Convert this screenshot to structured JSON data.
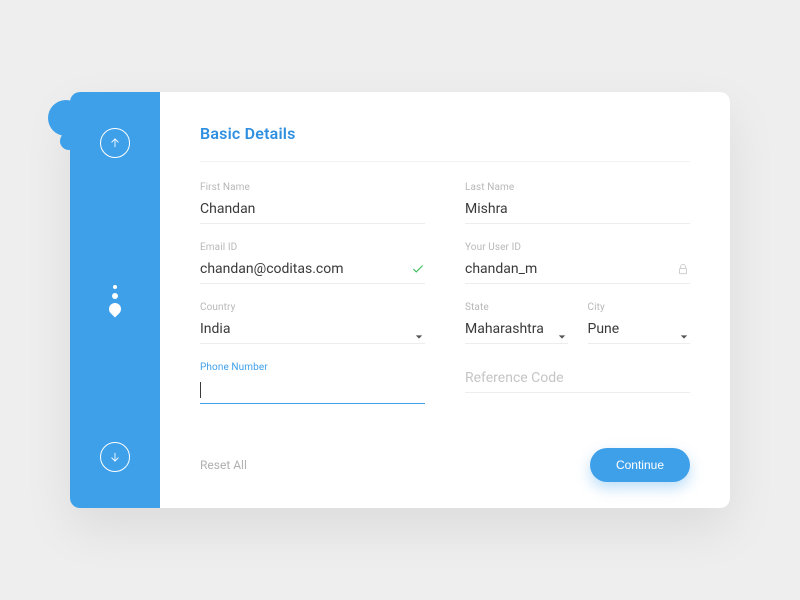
{
  "title": "Basic Details",
  "fields": {
    "firstName": {
      "label": "First Name",
      "value": "Chandan"
    },
    "lastName": {
      "label": "Last Name",
      "value": "Mishra"
    },
    "email": {
      "label": "Email ID",
      "value": "chandan@coditas.com"
    },
    "userId": {
      "label": "Your User ID",
      "value": "chandan_m"
    },
    "country": {
      "label": "Country",
      "value": "India"
    },
    "state": {
      "label": "State",
      "value": "Maharashtra"
    },
    "city": {
      "label": "City",
      "value": "Pune"
    },
    "phone": {
      "label": "Phone Number",
      "value": ""
    },
    "reference": {
      "label": "",
      "placeholder": "Reference Code"
    }
  },
  "footer": {
    "reset": "Reset All",
    "continue": "Continue"
  }
}
